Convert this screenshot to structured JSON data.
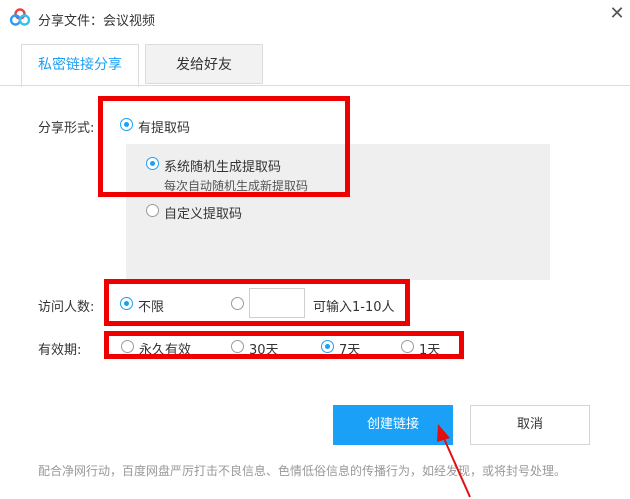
{
  "window": {
    "title": "分享文件：会议视频",
    "close_icon": "close-icon"
  },
  "tabs": [
    {
      "label": "私密链接分享",
      "active": true
    },
    {
      "label": "发给好友",
      "active": false
    }
  ],
  "share_form": {
    "label": "分享形式:",
    "option_with_code": "有提取码",
    "option_random": "系统随机生成提取码",
    "option_random_desc": "每次自动随机生成新提取码",
    "option_custom": "自定义提取码"
  },
  "visitors": {
    "label": "访问人数:",
    "option_unlimited": "不限",
    "input_value": "",
    "input_hint": "可输入1-10人"
  },
  "validity": {
    "label": "有效期:",
    "options": [
      "永久有效",
      "30天",
      "7天",
      "1天"
    ],
    "selected_index": 2
  },
  "buttons": {
    "create": "创建链接",
    "cancel": "取消"
  },
  "footer": {
    "notice": "配合净网行动，百度网盘严厉打击不良信息、色情低俗信息的传播行为，如经发现，或将封号处理。"
  },
  "colors": {
    "accent": "#1aa1f7",
    "annotation_red": "#ee0000"
  }
}
